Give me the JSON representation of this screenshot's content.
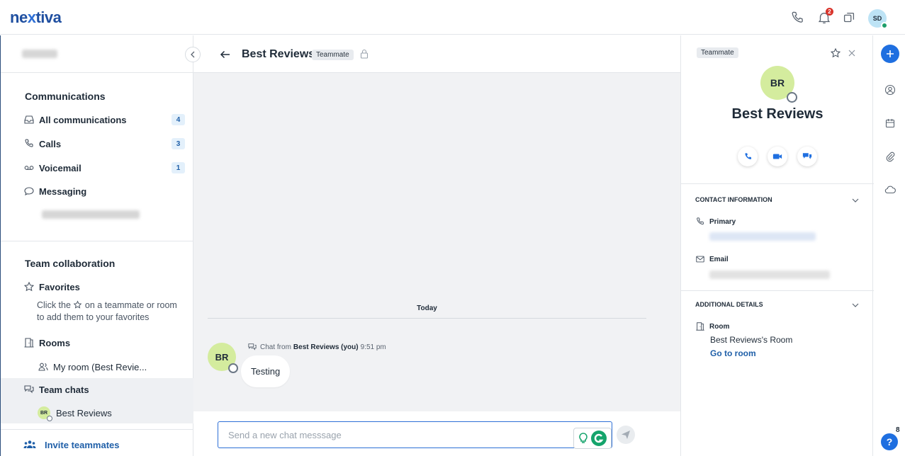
{
  "app": {
    "logo_text_pre": "ne",
    "logo_text_x": "x",
    "logo_text_post": "tiva"
  },
  "topbar": {
    "notification_count": "2",
    "user_initials": "SD"
  },
  "sidebar": {
    "communications": {
      "heading": "Communications",
      "items": [
        {
          "label": "All communications",
          "count": "4"
        },
        {
          "label": "Calls",
          "count": "3"
        },
        {
          "label": "Voicemail",
          "count": "1"
        },
        {
          "label": "Messaging"
        }
      ]
    },
    "team": {
      "heading": "Team collaboration",
      "favorites_label": "Favorites",
      "favorites_hint_pre": "Click the",
      "favorites_hint_post": "on a teammate or room to add them to your favorites",
      "rooms_label": "Rooms",
      "room_item": "My room (Best Revie...",
      "team_chats_label": "Team chats",
      "team_chat_item": {
        "initials": "BR",
        "name": "Best Reviews"
      }
    },
    "invite_label": "Invite teammates"
  },
  "chat": {
    "title": "Best Reviews",
    "tag": "Teammate",
    "day_label": "Today",
    "message": {
      "initials": "BR",
      "meta_pre": "Chat from",
      "sender": "Best Reviews (you)",
      "time": "9:51 pm",
      "text": "Testing"
    },
    "input_placeholder": "Send a new chat messsage"
  },
  "profile": {
    "tag": "Teammate",
    "initials": "BR",
    "name": "Best Reviews",
    "contact_heading": "CONTACT INFORMATION",
    "primary_label": "Primary",
    "email_label": "Email",
    "additional_heading": "ADDITIONAL DETAILS",
    "room_label": "Room",
    "room_value": "Best Reviews's Room",
    "go_to_room": "Go to room"
  },
  "rail": {
    "help_badge": "8"
  },
  "colors": {
    "accent": "#1f6fe0",
    "avatar_bg": "#d4ec9e",
    "badge_red": "#d9342b",
    "link": "#1f5fa8"
  }
}
